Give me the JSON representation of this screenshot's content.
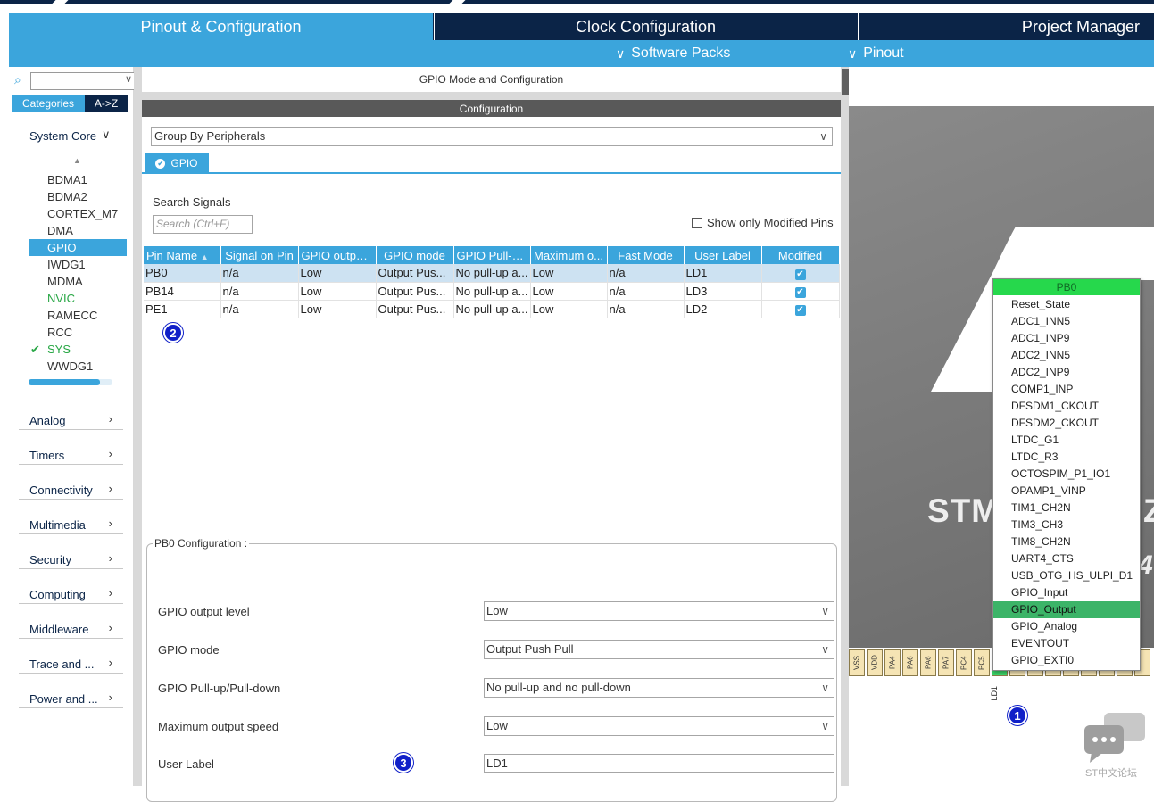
{
  "tabs": {
    "pinout": "Pinout & Configuration",
    "clock": "Clock Configuration",
    "project": "Project Manager"
  },
  "subbar": {
    "software_packs": "Software Packs",
    "pinout": "Pinout"
  },
  "sidebar": {
    "categories_tab": "Categories",
    "az_tab": "A->Z",
    "system_core": "System Core",
    "system_core_items": [
      {
        "label": "BDMA1"
      },
      {
        "label": "BDMA2"
      },
      {
        "label": "CORTEX_M7"
      },
      {
        "label": "DMA"
      },
      {
        "label": "GPIO"
      },
      {
        "label": "IWDG1"
      },
      {
        "label": "MDMA"
      },
      {
        "label": "NVIC"
      },
      {
        "label": "RAMECC"
      },
      {
        "label": "RCC"
      },
      {
        "label": "SYS"
      },
      {
        "label": "WWDG1"
      }
    ],
    "sections": [
      "Analog",
      "Timers",
      "Connectivity",
      "Multimedia",
      "Security",
      "Computing",
      "Middleware",
      "Trace and ...",
      "Power and ..."
    ]
  },
  "middle": {
    "title": "GPIO Mode and Configuration",
    "config_header": "Configuration",
    "group_by": "Group By Peripherals",
    "gpio_tab": "GPIO",
    "search_label": "Search Signals",
    "search_placeholder": "Search (Ctrl+F)",
    "modified_only": "Show only Modified Pins",
    "columns": [
      "Pin Name",
      "Signal on Pin",
      "GPIO output...",
      "GPIO mode",
      "GPIO Pull-u...",
      "Maximum o...",
      "Fast Mode",
      "User Label",
      "Modified"
    ],
    "rows": [
      {
        "pin": "PB0",
        "signal": "n/a",
        "output": "Low",
        "mode": "Output Pus...",
        "pull": "No pull-up a...",
        "speed": "Low",
        "fast": "n/a",
        "label": "LD1"
      },
      {
        "pin": "PB14",
        "signal": "n/a",
        "output": "Low",
        "mode": "Output Pus...",
        "pull": "No pull-up a...",
        "speed": "Low",
        "fast": "n/a",
        "label": "LD3"
      },
      {
        "pin": "PE1",
        "signal": "n/a",
        "output": "Low",
        "mode": "Output Pus...",
        "pull": "No pull-up a...",
        "speed": "Low",
        "fast": "n/a",
        "label": "LD2"
      }
    ],
    "pb0_config": {
      "legend": "PB0 Configuration :",
      "output_level_label": "GPIO output level",
      "output_level_value": "Low",
      "mode_label": "GPIO mode",
      "mode_value": "Output Push Pull",
      "pull_label": "GPIO Pull-up/Pull-down",
      "pull_value": "No pull-up and no pull-down",
      "speed_label": "Maximum output speed",
      "speed_value": "Low",
      "user_label_label": "User Label",
      "user_label_value": "LD1"
    },
    "badges": {
      "two": "2",
      "three": "3"
    }
  },
  "chip": {
    "name_partial": "STM",
    "name_right": "Z",
    "number_partial": "4",
    "pin_menu_header": "PB0",
    "pin_menu_items": [
      {
        "label": "Reset_State"
      },
      {
        "label": "ADC1_INN5"
      },
      {
        "label": "ADC1_INP9"
      },
      {
        "label": "ADC2_INN5"
      },
      {
        "label": "ADC2_INP9"
      },
      {
        "label": "COMP1_INP"
      },
      {
        "label": "DFSDM1_CKOUT"
      },
      {
        "label": "DFSDM2_CKOUT"
      },
      {
        "label": "LTDC_G1"
      },
      {
        "label": "LTDC_R3"
      },
      {
        "label": "OCTOSPIM_P1_IO1"
      },
      {
        "label": "OPAMP1_VINP"
      },
      {
        "label": "TIM1_CH2N"
      },
      {
        "label": "TIM3_CH3"
      },
      {
        "label": "TIM8_CH2N"
      },
      {
        "label": "UART4_CTS"
      },
      {
        "label": "USB_OTG_HS_ULPI_D1"
      },
      {
        "label": "GPIO_Input"
      },
      {
        "label": "GPIO_Output"
      },
      {
        "label": "GPIO_Analog"
      },
      {
        "label": "EVENTOUT"
      },
      {
        "label": "GPIO_EXTI0"
      }
    ],
    "pins": [
      "VSS",
      "VDD",
      "PA4",
      "PA6",
      "PA6",
      "PA7",
      "PC4",
      "PC5"
    ],
    "ld1_label": "LD1",
    "badge_one": "1",
    "watermark": "ST中文论坛"
  },
  "colors": {
    "accent": "#3ba5dc",
    "navy": "#0b2447",
    "pin_green": "#26d84c",
    "badge_blue": "#1020c8"
  }
}
